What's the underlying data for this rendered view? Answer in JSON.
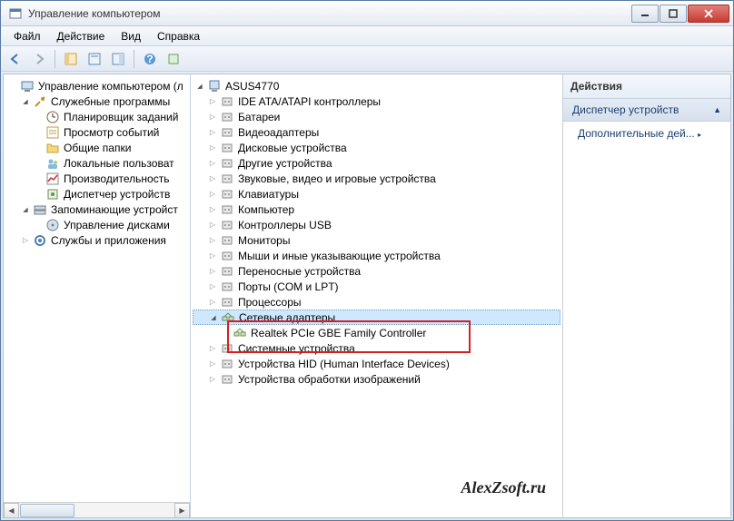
{
  "window": {
    "title": "Управление компьютером"
  },
  "menu": [
    "Файл",
    "Действие",
    "Вид",
    "Справка"
  ],
  "left_tree": {
    "root": "Управление компьютером (л",
    "groups": [
      {
        "label": "Служебные программы",
        "expanded": true,
        "children": [
          "Планировщик заданий",
          "Просмотр событий",
          "Общие папки",
          "Локальные пользоват",
          "Производительность",
          "Диспетчер устройств"
        ]
      },
      {
        "label": "Запоминающие устройст",
        "expanded": true,
        "children": [
          "Управление дисками"
        ]
      },
      {
        "label": "Службы и приложения",
        "expanded": false,
        "children": []
      }
    ]
  },
  "mid_tree": {
    "root": "ASUS4770",
    "categories": [
      "IDE ATA/ATAPI контроллеры",
      "Батареи",
      "Видеоадаптеры",
      "Дисковые устройства",
      "Другие устройства",
      "Звуковые, видео и игровые устройства",
      "Клавиатуры",
      "Компьютер",
      "Контроллеры USB",
      "Мониторы",
      "Мыши и иные указывающие устройства",
      "Переносные устройства",
      "Порты (COM и LPT)",
      "Процессоры"
    ],
    "expanded_category": {
      "label": "Сетевые адаптеры",
      "device": "Realtek PCIe GBE Family Controller"
    },
    "categories_after": [
      "Системные устройства",
      "Устройства HID (Human Interface Devices)",
      "Устройства обработки изображений"
    ]
  },
  "actions": {
    "header": "Действия",
    "section": "Диспетчер устройств",
    "link": "Дополнительные дей..."
  },
  "watermark": "AlexZsoft.ru"
}
